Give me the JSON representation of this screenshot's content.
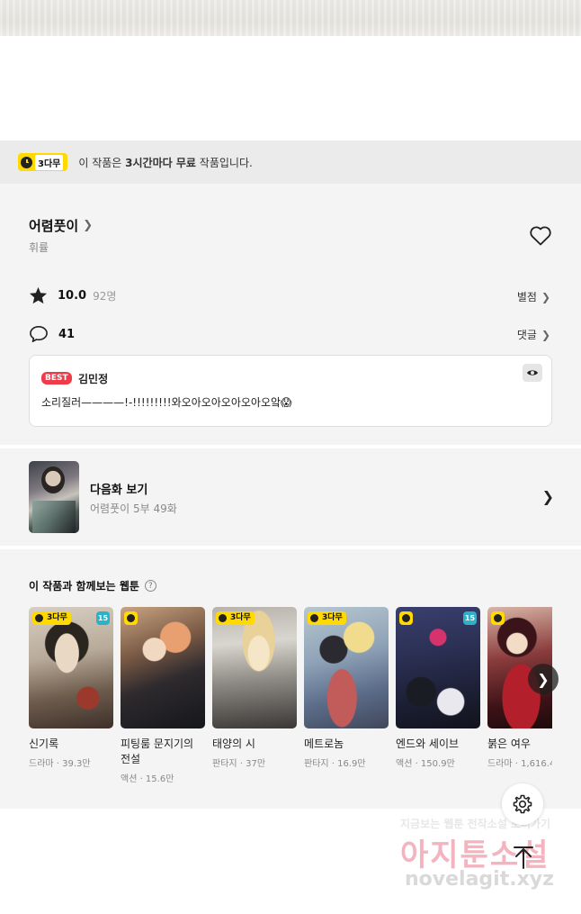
{
  "notice": {
    "badge": "3다무",
    "prefix": "이 작품은",
    "bold": "3시간마다 무료",
    "suffix": "작품입니다."
  },
  "work": {
    "title": "어렴풋이",
    "author": "휘률"
  },
  "rating": {
    "score": "10.0",
    "count": "92명",
    "link": "별점"
  },
  "comments": {
    "count": "41",
    "link": "댓글"
  },
  "best_comment": {
    "badge": "BEST",
    "name": "김민정",
    "text": "소리질러————!-!!!!!!!!!와오아오아오아오아오앜😱"
  },
  "next_episode": {
    "title": "다음화 보기",
    "sub": "어렴풋이 5부 49화"
  },
  "recommend": {
    "title": "이 작품과 함께보는 웹툰",
    "help_icon": "?",
    "items": [
      {
        "name": "신기록",
        "meta": "드라마 · 39.3만",
        "tag": "3다무",
        "age": "15"
      },
      {
        "name": "피팅룸 문지기의 전설",
        "meta": "액션 · 15.6만",
        "tag": "",
        "age": ""
      },
      {
        "name": "태양의 시",
        "meta": "판타지 · 37만",
        "tag": "3다무",
        "age": ""
      },
      {
        "name": "메트로놈",
        "meta": "판타지 · 16.9만",
        "tag": "3다무",
        "age": ""
      },
      {
        "name": "엔드와 세이브",
        "meta": "액션 · 150.9만",
        "tag": "",
        "age": "15"
      },
      {
        "name": "붉은 여우",
        "meta": "드라마 · 1,616.4",
        "tag": "",
        "age": ""
      }
    ]
  },
  "watermark": {
    "line1": "지금보는 웹툰 전작소설 보러가기",
    "line2": "아지툰소설",
    "line3": "novelagit.xyz"
  },
  "colors": {
    "accent_yellow": "#ffd900",
    "best_red": "#ef3c4b",
    "age_teal": "#2cb1c9"
  }
}
